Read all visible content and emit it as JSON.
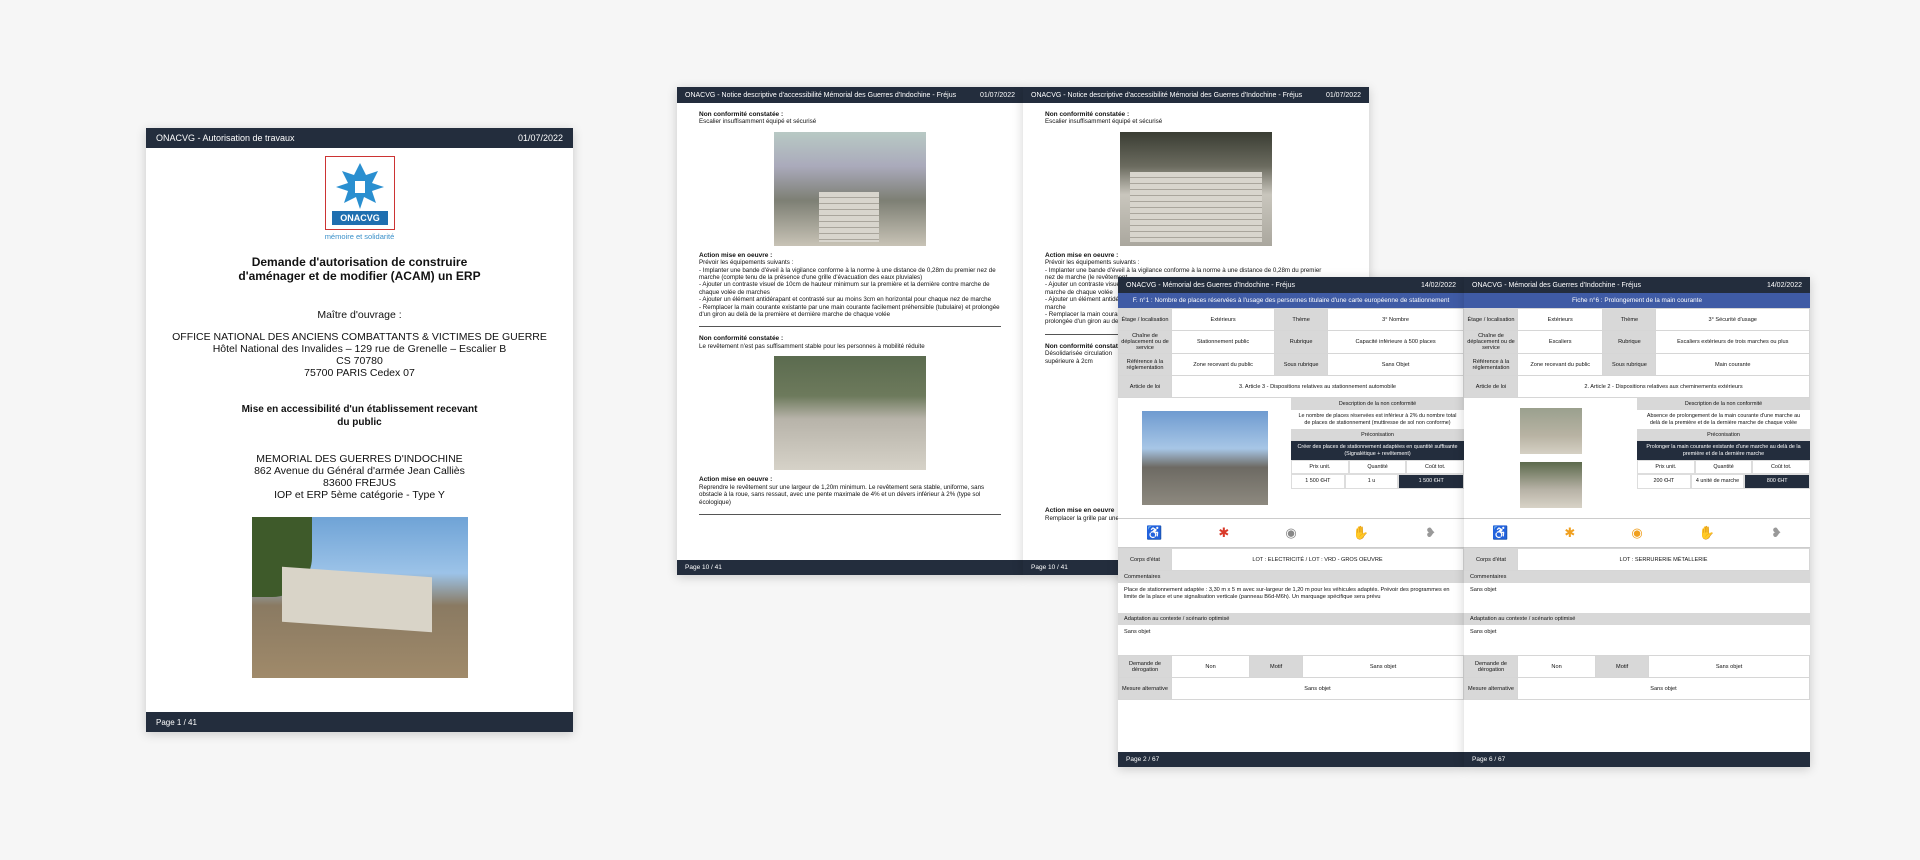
{
  "cover": {
    "header_left": "ONACVG - Autorisation de travaux",
    "header_date": "01/07/2022",
    "logo_name": "ONACVG",
    "logo_tagline": "mémoire et solidarité",
    "title1": "Demande d'autorisation de construire",
    "title2": "d'aménager et de modifier (ACAM) un ERP",
    "maitre": "Maître d'ouvrage :",
    "owner1": "OFFICE NATIONAL DES ANCIENS COMBATTANTS & VICTIMES DE GUERRE",
    "owner2": "Hôtel National des Invalides – 129 rue de Grenelle – Escalier B",
    "owner3": "CS 70780",
    "owner4": "75700 PARIS Cedex 07",
    "bold1": "Mise en accessibilité d'un établissement recevant",
    "bold2": "du public",
    "mem1": "MEMORIAL DES GUERRES D'INDOCHINE",
    "mem2": "862 Avenue du Général d'armée Jean Calliès",
    "mem3": "83600 FREJUS",
    "mem4": "IOP et ERP 5ème catégorie - Type Y",
    "footer": "Page 1 / 41"
  },
  "spread_left": {
    "header_left": "ONACVG - Notice descriptive d'accessibilité Mémorial des Guerres d'Indochine - Fréjus",
    "header_date": "01/07/2022",
    "nc1_title": "Non conformité constatée :",
    "nc1_text": "Escalier insuffisamment équipé et sécurisé",
    "act1_title": "Action mise en oeuvre :",
    "act1_lines": [
      "Prévoir les équipements suivants :",
      "- Implanter une bande d'éveil à la vigilance conforme à la norme à une distance de 0,28m du premier nez de marche (compte tenu de la présence d'une grille d'évacuation des eaux pluviales)",
      "- Ajouter un contraste visuel de 10cm de hauteur minimum sur la première et la dernière contre marche de chaque volée de marches",
      "- Ajouter un élément antidérapant et contrasté sur au moins 3cm en horizontal pour chaque nez de marche",
      "- Remplacer la main courante existante par une main courante facilement préhensible (tubulaire) et prolongée d'un giron au delà de la première et dernière marche de chaque volée"
    ],
    "nc2_title": "Non conformité constatée :",
    "nc2_text": "Le revêtement n'est pas suffisamment stable pour les personnes à mobilité réduite",
    "act2_title": "Action mise en oeuvre :",
    "act2_text": "Reprendre le revêtement sur une largeur de 1,20m minimum. Le revêtement sera stable, uniforme, sans obstacle à la roue, sans ressaut, avec une pente maximale de 4% et un dévers inférieur à 2% (type sol écologique)",
    "footer": "Page 10 / 41"
  },
  "spread_right": {
    "header_left": "ONACVG - Notice descriptive d'accessibilité Mémorial des Guerres d'Indochine - Fréjus",
    "header_date": "01/07/2022",
    "nc1_title": "Non conformité constatée :",
    "nc1_text": "Escalier insuffisamment équipé et sécurisé",
    "act1_title": "Action mise en oeuvre :",
    "act1_lines": [
      "Prévoir les équipements suivants :",
      "- Implanter une bande d'éveil à la vigilance conforme à la norme à une distance de 0,28m du premier",
      "nez de marche (le revêtement",
      "- Ajouter un contraste visuel",
      "marche de chaque volée",
      "- Ajouter un élément antidérapant",
      "marche",
      "- Remplacer la main courante",
      "prolongée d'un giron au delà"
    ],
    "nc2_title": "Non conformité constatée",
    "nc2_lines": [
      "Désolidarisée circulation",
      "supérieure à 2cm"
    ],
    "act2_title": "Action mise en oeuvre",
    "act2_text": "Remplacer la grille par une",
    "footer": "Page 10 / 41"
  },
  "sheet1": {
    "header_left": "ONACVG - Mémorial des Guerres d'Indochine - Fréjus",
    "header_date": "14/02/2022",
    "fiche": "F. n°1 : Nombre de places réservées à l'usage des personnes titulaire d'une carte européenne de stationnement",
    "labels": {
      "etage": "Étage / localisation",
      "theme": "Thème",
      "cheminement": "Chaîne de déplacement ou de service",
      "rubrique": "Rubrique",
      "reference": "Référence à la réglementation",
      "sousrub": "Sous rubrique",
      "article": "Article de loi"
    },
    "etage": "Extérieurs",
    "theme": "3° Nombre",
    "cheminement": "Stationnement public",
    "rubrique": "Capacité inférieure à 500 places",
    "reference": "Zone recevant du public",
    "sousrub": "Sans Objet",
    "article": "3. Article 3 - Dispositions relatives au stationnement automobile",
    "desc_h": "Description de la non conformité",
    "desc_t": "Le nombre de places réservées est inférieur à 2% du nombre total de places de stationnement (muttiresse de sol non conforme)",
    "preco_h": "Préconisation",
    "preco_t": "Créer des places de stationnement adaptées en quantité suffisante (Signalétique + revêtement)",
    "pu_l": "Prix unit.",
    "qt_l": "Quantité",
    "ct_l": "Coût tot.",
    "pu": "1 500 €HT",
    "qt": "1 u",
    "ct": "1 500 €HT",
    "corps_l": "Corps d'état",
    "corps": "LOT : ELECTRICITÉ / LOT : VRD - GROS OEUVRE",
    "comm_h": "Commentaires",
    "comm": "Place de stationnement adaptée : 3,30 m x 5 m avec sur-largeur de 1,20 m pour les véhicules adaptés. Prévoir des programmes en limite de la place et une signalisation verticale (panneau B6d-M6h). Un marquage spécifique sera prévu",
    "adapt_h": "Adaptation au contexte / scénario optimisé",
    "adapt": "Sans objet",
    "derog_l": "Demande de dérogation",
    "derog": "Non",
    "motif_l": "Motif",
    "motif": "Sans objet",
    "mesure_l": "Mesure alternative",
    "mesure": "Sans objet",
    "footer": "Page 2 / 67"
  },
  "sheet2": {
    "header_left": "ONACVG - Mémorial des Guerres d'Indochine - Fréjus",
    "header_date": "14/02/2022",
    "fiche": "Fiche n°6 : Prolongement de la main courante",
    "etage": "Extérieurs",
    "theme": "3° Sécurité d'usage",
    "cheminement": "Escaliers",
    "rubrique": "Escaliers extérieurs de trois marches ou plus",
    "reference": "Zone recevant du public",
    "sousrub": "Main courante",
    "article": "2. Article 2 - Dispositions relatives aux cheminements extérieurs",
    "desc_h": "Description de la non conformité",
    "desc_t": "Absence de prolongement de la main courante d'une marche au delà de la première et de la dernière marche de chaque volée",
    "preco_h": "Préconisation",
    "preco_t": "Prolonger la main courante existante d'une marche au delà de la première et de la dernière marche",
    "pu": "200 €HT",
    "qt": "4 unité de marche",
    "ct": "800 €HT",
    "corps": "LOT : SERRURERIE MÉTALLERIE",
    "comm": "Sans objet",
    "adapt": "Sans objet",
    "derog": "Non",
    "motif": "Sans objet",
    "mesure": "Sans objet",
    "footer": "Page 6 / 67"
  }
}
